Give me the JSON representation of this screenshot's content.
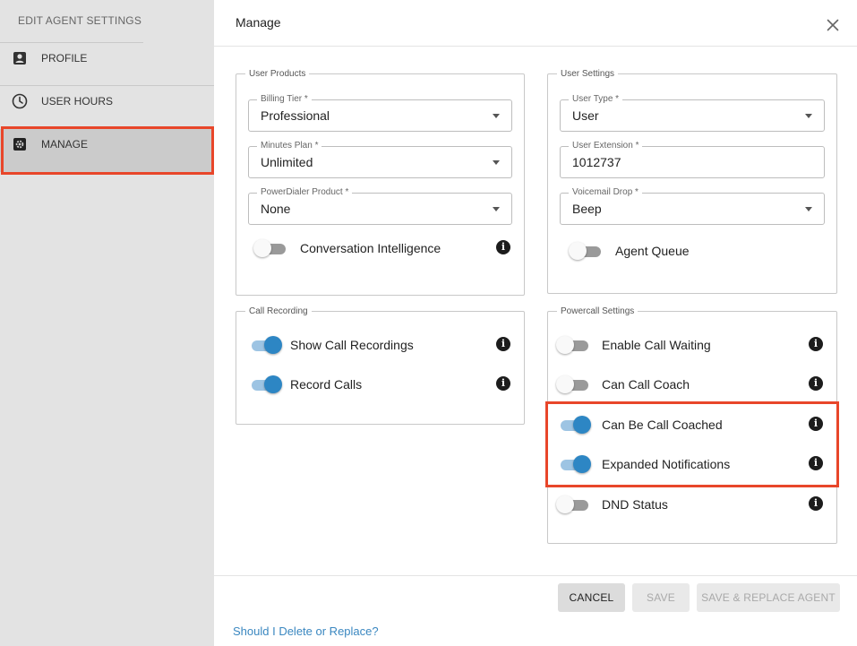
{
  "sidebar": {
    "title": "EDIT AGENT SETTINGS",
    "items": [
      {
        "label": "PROFILE",
        "icon": "profile-icon"
      },
      {
        "label": "USER HOURS",
        "icon": "clock-icon"
      },
      {
        "label": "MANAGE",
        "icon": "gear-icon",
        "active": true
      }
    ]
  },
  "main": {
    "title": "Manage",
    "user_products": {
      "legend": "User Products",
      "billing_tier": {
        "label": "Billing Tier *",
        "value": "Professional"
      },
      "minutes_plan": {
        "label": "Minutes Plan *",
        "value": "Unlimited"
      },
      "powerdialer_product": {
        "label": "PowerDialer Product *",
        "value": "None"
      },
      "conversation_intelligence": {
        "label": "Conversation Intelligence",
        "enabled": false
      }
    },
    "user_settings": {
      "legend": "User Settings",
      "user_type": {
        "label": "User Type *",
        "value": "User"
      },
      "user_extension": {
        "label": "User Extension *",
        "value": "1012737"
      },
      "voicemail_drop": {
        "label": "Voicemail Drop *",
        "value": "Beep"
      },
      "agent_queue": {
        "label": "Agent Queue",
        "enabled": false
      }
    },
    "call_recording": {
      "legend": "Call Recording",
      "show_call_recordings": {
        "label": "Show Call Recordings",
        "enabled": true
      },
      "record_calls": {
        "label": "Record Calls",
        "enabled": true
      }
    },
    "powercall_settings": {
      "legend": "Powercall Settings",
      "enable_call_waiting": {
        "label": "Enable Call Waiting",
        "enabled": false
      },
      "can_call_coach": {
        "label": "Can Call Coach",
        "enabled": false
      },
      "can_be_call_coached": {
        "label": "Can Be Call Coached",
        "enabled": true
      },
      "expanded_notifications": {
        "label": "Expanded Notifications",
        "enabled": true
      },
      "dnd_status": {
        "label": "DND Status",
        "enabled": false
      }
    },
    "info_glyph": "i"
  },
  "footer": {
    "cancel_label": "CANCEL",
    "save_label": "SAVE",
    "save_replace_label": "SAVE & REPLACE AGENT",
    "help_link": "Should I Delete or Replace?"
  },
  "colors": {
    "accent": "#2d86c4",
    "highlight": "#e8462a",
    "link": "#3a87c0"
  }
}
